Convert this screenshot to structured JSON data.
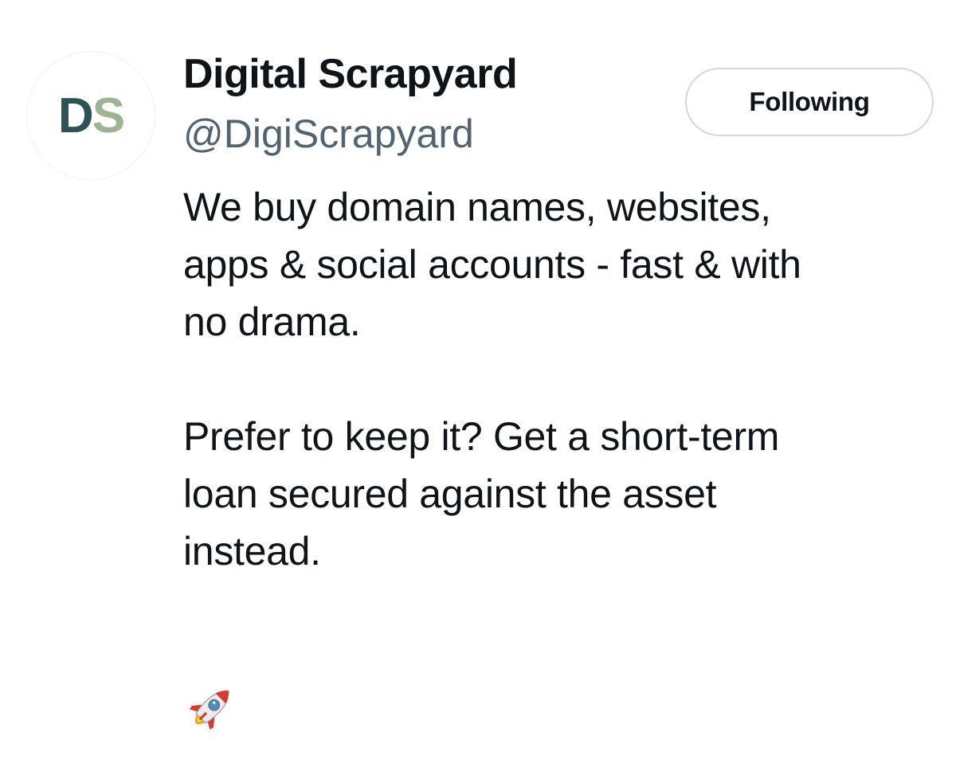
{
  "profile": {
    "avatar_initials": [
      "D",
      "S"
    ],
    "display_name": "Digital Scrapyard",
    "handle": "@DigiScrapyard",
    "follow_button_label": "Following",
    "bio_paragraph_1": [
      "We buy domain names, websites,",
      "apps & social accounts - fast & with",
      "no drama."
    ],
    "bio_paragraph_2": [
      "Prefer to keep it? Get a short-term",
      "loan secured against the asset",
      "instead."
    ],
    "bio_icon": "rocket-icon"
  },
  "colors": {
    "avatar_d": "#2f5354",
    "avatar_s": "#9db394",
    "handle": "#536471",
    "text": "#0f1419",
    "button_border": "#cfd9de"
  }
}
